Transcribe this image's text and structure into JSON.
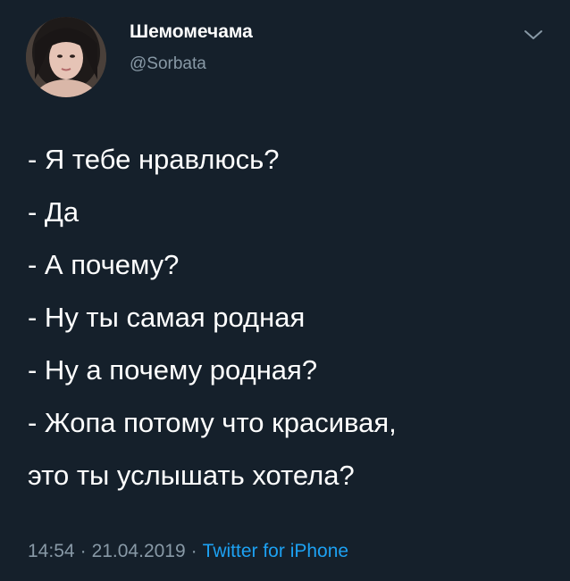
{
  "author": {
    "display_name": "Шемомечама",
    "handle": "@Sorbata"
  },
  "tweet": {
    "lines": [
      "- Я тебе нравлюсь?",
      "- Да",
      "- А почему?",
      "- Ну ты самая родная",
      "- Ну а почему родная?",
      "- Жопа потому что красивая,",
      "это ты услышать хотела?"
    ]
  },
  "meta": {
    "time": "14:54",
    "date": "21.04.2019",
    "separator": "·",
    "source": "Twitter for iPhone"
  },
  "icons": {
    "menu": "chevron-down-icon"
  },
  "colors": {
    "background": "#15202b",
    "text_primary": "#ffffff",
    "text_secondary": "#8899a6",
    "link": "#1da1f2"
  }
}
